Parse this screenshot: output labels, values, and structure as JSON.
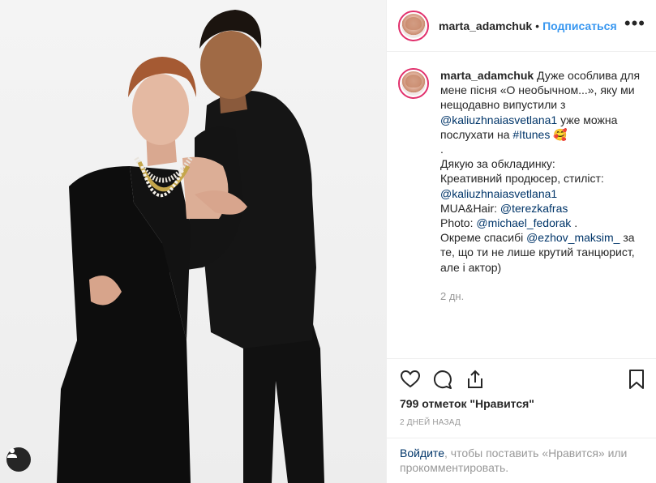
{
  "post": {
    "username": "marta_adamchuk",
    "separator": "•",
    "follow_label": "Подписаться",
    "more_icon": "more-horizontal-icon",
    "more_label": "•••"
  },
  "comment": {
    "username": "marta_adamchuk",
    "part1": " Дуже особлива для мене пісня «О необычном...», яку ми нещодавно випустили з ",
    "mention1": "@kaliuzhnaiasvetlana1",
    "part2": " уже можна послухати на ",
    "hashtag1": "#Itunes",
    "emoji": "🥰",
    "line_dot": ".",
    "thanks": "Дякую за обкладинку:",
    "producer": "Креативний продюсер, стиліст:",
    "mention2": "@kaliuzhnaiasvetlana1",
    "mua_label": "MUA&Hair: ",
    "mention3": "@terezkafras",
    "photo_label": "Photo: ",
    "mention4": "@michael_fedorak",
    "photo_end": " .",
    "special": "Окреме спасибі ",
    "mention5": "@ezhov_maksim_",
    "special_end": " за те, що ти не лише крутий танцюрист, але і актор)",
    "time": "2 дн."
  },
  "actions": {
    "likes": "799 отметок \"Нравится\"",
    "date": "2 дней назад"
  },
  "login": {
    "link": "Войдите",
    "text": ", чтобы поставить «Нравится» или прокомментировать."
  },
  "colors": {
    "accent": "#3897f0",
    "link": "#003569",
    "muted": "#999999",
    "text": "#262626",
    "border": "#efefef"
  }
}
